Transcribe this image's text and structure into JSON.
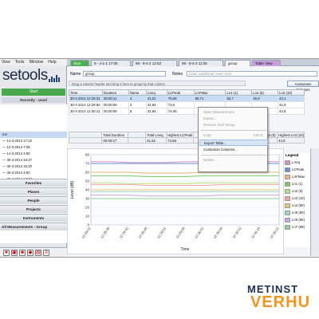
{
  "menu": [
    "View",
    "Tools",
    "Window",
    "Help"
  ],
  "tabs": [
    {
      "label": "Start",
      "kind": "start"
    },
    {
      "label": "9 - 4-1-1 17:05",
      "kind": ""
    },
    {
      "label": "99 - 8-4-2 12:53",
      "kind": ""
    },
    {
      "label": "99 - 8-4-2 11:05",
      "kind": ""
    },
    {
      "label": "group",
      "kind": "active"
    },
    {
      "label": "Table View",
      "kind": "tv"
    }
  ],
  "sidebar": {
    "logo": "setools",
    "start_label": "Start",
    "recent_label": "Recently - Used",
    "tree": [
      {
        "label": "me",
        "hl": true
      },
      {
        "label": "— 14-3-2014 17:22",
        "hl": false
      },
      {
        "label": "— 12-3-2014 7:05",
        "hl": false
      },
      {
        "label": "— 14-3-2014 4:50",
        "hl": false
      },
      {
        "label": "— 30-4-2014 16:27",
        "hl": false
      },
      {
        "label": "— 30-4-2014 15:20",
        "hl": false
      },
      {
        "label": "— 30-4-2014 4:50",
        "hl": false
      },
      {
        "label": "— 30-4-2014 12:53",
        "hl": false
      }
    ],
    "sections": [
      "Favorites",
      "Places",
      "People",
      "Projects",
      "Instruments",
      "All Measurements - Group"
    ]
  },
  "main": {
    "name_label": "Name",
    "name_value": "group",
    "notes_label": "Notes",
    "notes_placeholder": "Enter additional notes here",
    "hint": "Drag a column header and drop it here to group by that column",
    "customize_label": "Customize Columns",
    "columns": [
      "Time",
      "Duration",
      "Name",
      "LAeq",
      "LCPeak",
      "LAFMax",
      "Ln1 (1)",
      "Ln2 (5)",
      "Ln3 (10)"
    ],
    "rows": [
      {
        "cells": [
          "30-4-2014 12:29:31",
          "00:00:11",
          "4",
          "41,01",
          "75,68",
          "55,71",
          "50,7",
          "46,9",
          "42,1"
        ],
        "sel": true
      },
      {
        "cells": [
          "30-4-2014 12:29:50",
          "00:00:08",
          "3",
          "42,94",
          "73,6",
          "",
          "",
          "",
          "41,6"
        ],
        "sel": false
      },
      {
        "cells": [
          "30-4-2014 12:30:12",
          "00:00:08",
          "5",
          "42,94",
          "74,05",
          "",
          "",
          "",
          "44,8"
        ],
        "sel": false
      }
    ],
    "summary_labels": [
      "",
      "Total Duration",
      "",
      "Total LAeq",
      "Highest LCPeak",
      "",
      "",
      "Highest Ln2 (5)",
      "Highest Ln3 (10)"
    ],
    "summary_values": [
      "",
      "00:00:27",
      "",
      "41,82",
      "73,68",
      "",
      "",
      "50,1",
      "44,8"
    ]
  },
  "context_menu": {
    "items": [
      {
        "label": "Open Measurement",
        "enabled": false
      },
      {
        "label": "Export...",
        "enabled": false
      },
      {
        "label": "Remove from Group",
        "enabled": false
      },
      {
        "label": "Copy",
        "enabled": false,
        "shortcut": "Ctrl+C"
      },
      {
        "label": "Export Table...",
        "enabled": true,
        "highlighted": true
      },
      {
        "label": "Customize Columns...",
        "enabled": true
      },
      {
        "label": "Delete...",
        "enabled": false
      }
    ]
  },
  "chart_data": {
    "type": "line",
    "title": "",
    "xlabel": "Time",
    "ylabel": "Level (dB)",
    "ylim": [
      0,
      80
    ],
    "yticks": [
      0,
      10,
      20,
      30,
      40,
      50,
      60,
      70,
      80
    ],
    "x": [
      "12:29:31",
      "12:29:36",
      "12:29:41",
      "12:29:46",
      "12:29:51",
      "12:29:56",
      "12:30:01",
      "12:30:06",
      "12:30:11",
      "12:30:16",
      "12:30:21"
    ],
    "series": [
      {
        "name": "LAeq",
        "color": "#d98fc6",
        "values": [
          72,
          72,
          71,
          71,
          71,
          72,
          72,
          72,
          72,
          72,
          72
        ]
      },
      {
        "name": "LCPeak",
        "color": "#6a8fd6",
        "values": [
          70,
          70,
          70,
          70,
          70,
          70,
          70,
          70,
          70,
          70,
          70
        ]
      },
      {
        "name": "LAFMax",
        "color": "#e8b87a",
        "values": [
          60,
          60,
          60,
          59,
          59,
          59,
          60,
          60,
          60,
          60,
          60
        ]
      },
      {
        "name": "Ln1 (1)",
        "color": "#7cc96a",
        "values": [
          56,
          56,
          56,
          55,
          55,
          55,
          56,
          56,
          56,
          56,
          56
        ]
      },
      {
        "name": "Ln2 (5)",
        "color": "#b9e07c",
        "values": [
          48,
          48,
          47,
          47,
          47,
          47,
          48,
          48,
          48,
          48,
          48
        ]
      },
      {
        "name": "Ln3 (10)",
        "color": "#f3a4a4",
        "values": [
          46,
          46,
          46,
          45,
          45,
          45,
          45,
          46,
          46,
          46,
          46
        ]
      },
      {
        "name": "Ln4 (50)",
        "color": "#e6c96b",
        "values": [
          40,
          40,
          40,
          40,
          40,
          40,
          40,
          40,
          40,
          40,
          40
        ]
      },
      {
        "name": "Ln5 (90)",
        "color": "#9ad4c9",
        "values": [
          38,
          38,
          38,
          38,
          38,
          38,
          38,
          38,
          38,
          38,
          38
        ]
      },
      {
        "name": "Ln6 (95)",
        "color": "#c7a8e0",
        "values": [
          34,
          34,
          34,
          33,
          33,
          33,
          33,
          34,
          34,
          34,
          34
        ]
      },
      {
        "name": "Ln7 (99)",
        "color": "#8fd09a",
        "values": [
          30,
          30,
          30,
          30,
          30,
          30,
          30,
          30,
          30,
          30,
          30
        ]
      }
    ],
    "legend_title": "Legend"
  },
  "brand": {
    "line1": "METINST",
    "line2": "VERHU"
  }
}
